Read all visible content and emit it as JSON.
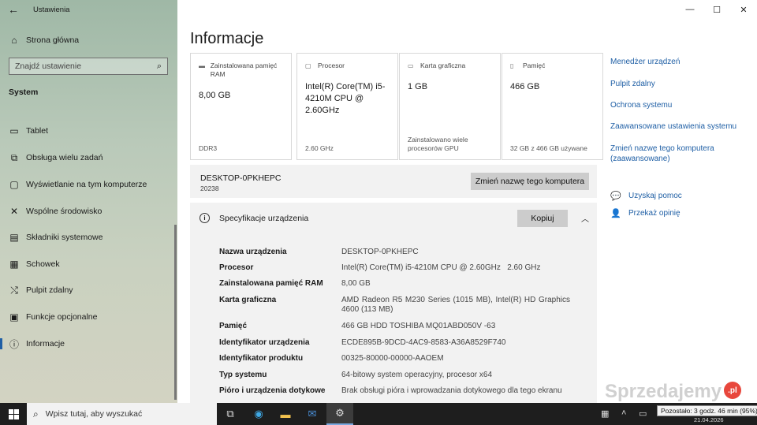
{
  "window": {
    "title": "Ustawienia",
    "controls": {
      "minimize": "—",
      "maximize": "☐",
      "close": "✕"
    }
  },
  "sidebar": {
    "home": "Strona główna",
    "search_placeholder": "Znajdź ustawienie",
    "section": "System",
    "items": [
      {
        "label": "Tablet",
        "icon": "tablet-icon"
      },
      {
        "label": "Obsługa wielu zadań",
        "icon": "multitasking-icon"
      },
      {
        "label": "Wyświetlanie na tym komputerze",
        "icon": "projecting-icon"
      },
      {
        "label": "Wspólne środowisko",
        "icon": "shared-experiences-icon"
      },
      {
        "label": "Składniki systemowe",
        "icon": "system-components-icon"
      },
      {
        "label": "Schowek",
        "icon": "clipboard-icon"
      },
      {
        "label": "Pulpit zdalny",
        "icon": "remote-desktop-icon"
      },
      {
        "label": "Funkcje opcjonalne",
        "icon": "optional-features-icon"
      },
      {
        "label": "Informacje",
        "icon": "info-icon"
      }
    ]
  },
  "main": {
    "title": "Informacje",
    "cards": [
      {
        "label": "Zainstalowana pamięć RAM",
        "value": "8,00 GB",
        "foot": "DDR3",
        "icon": "ram-icon"
      },
      {
        "label": "Procesor",
        "value": "Intel(R) Core(TM) i5-4210M CPU @ 2.60GHz",
        "foot": "2.60 GHz",
        "icon": "cpu-icon"
      },
      {
        "label": "Karta graficzna",
        "value": "1 GB",
        "foot": "Zainstalowano wiele procesorów GPU",
        "icon": "gpu-icon"
      },
      {
        "label": "Pamięć",
        "value": "466 GB",
        "foot": "32 GB z 466 GB używane",
        "icon": "storage-icon"
      }
    ],
    "pc": {
      "name": "DESKTOP-0PKHEPC",
      "build": "20238",
      "rename_button": "Zmień nazwę tego komputera"
    },
    "specs": {
      "title": "Specyfikacje urządzenia",
      "copy_button": "Kopiuj",
      "rows": [
        {
          "k": "Nazwa urządzenia",
          "v": "DESKTOP-0PKHEPC"
        },
        {
          "k": "Procesor",
          "v": "Intel(R) Core(TM) i5-4210M CPU @ 2.60GHz   2.60 GHz"
        },
        {
          "k": "Zainstalowana pamięć RAM",
          "v": "8,00 GB"
        },
        {
          "k": "Karta graficzna",
          "v": "AMD Radeon R5 M230 Series (1015 MB), Intel(R) HD Graphics 4600 (113 MB)"
        },
        {
          "k": "Pamięć",
          "v": "466 GB HDD TOSHIBA MQ01ABD050V -63"
        },
        {
          "k": "Identyfikator urządzenia",
          "v": "ECDE895B-9DCD-4AC9-8583-A36A8529F740"
        },
        {
          "k": "Identyfikator produktu",
          "v": "00325-80000-00000-AAOEM"
        },
        {
          "k": "Typ systemu",
          "v": "64-bitowy system operacyjny, procesor x64"
        },
        {
          "k": "Pióro i urządzenia dotykowe",
          "v": "Brak obsługi pióra i wprowadzania dotykowego dla tego ekranu"
        }
      ]
    },
    "related": [
      "Menedżer urządzeń",
      "Pulpit zdalny",
      "Ochrona systemu",
      "Zaawansowane ustawienia systemu",
      "Zmień nazwę tego komputera (zaawansowane)"
    ],
    "help": {
      "get_help": "Uzyskaj pomoc",
      "feedback": "Przekaż opinię"
    }
  },
  "watermark": {
    "text": "Sprzedajemy",
    "badge": ".pl"
  },
  "taskbar": {
    "search_placeholder": "Wpisz tutaj, aby wyszukać",
    "battery_tooltip": "Pozostało: 3 godz. 46 min (95%)",
    "date": "21.04.2026"
  }
}
